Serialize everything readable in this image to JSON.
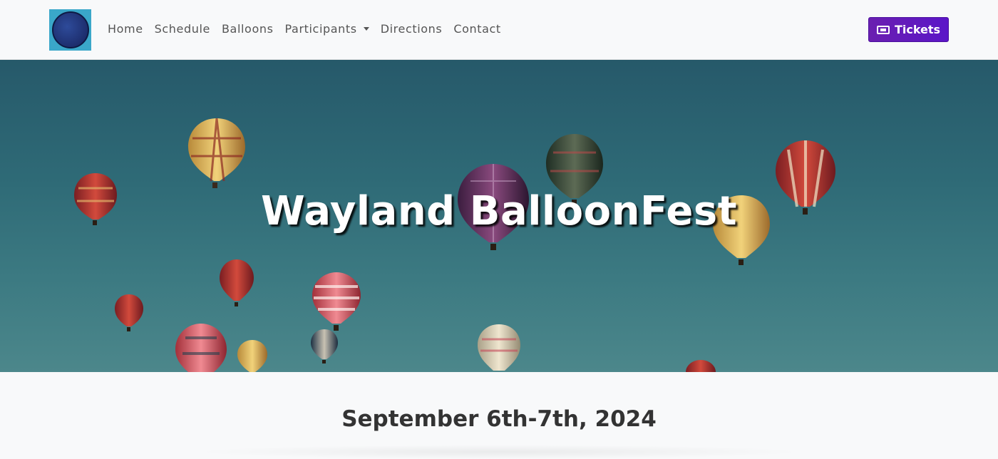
{
  "nav": {
    "items": [
      "Home",
      "Schedule",
      "Balloons",
      "Participants",
      "Directions",
      "Contact"
    ],
    "tickets_label": "Tickets"
  },
  "hero": {
    "title": "Wayland BalloonFest"
  },
  "event": {
    "dates": "September 6th-7th, 2024"
  },
  "icons": {
    "logo": "balloon-logo-icon",
    "tickets": "ticket-icon",
    "dropdown": "caret-down-icon"
  },
  "colors": {
    "accent": "#5b16c8",
    "hero_sky": "#2f6b77"
  }
}
